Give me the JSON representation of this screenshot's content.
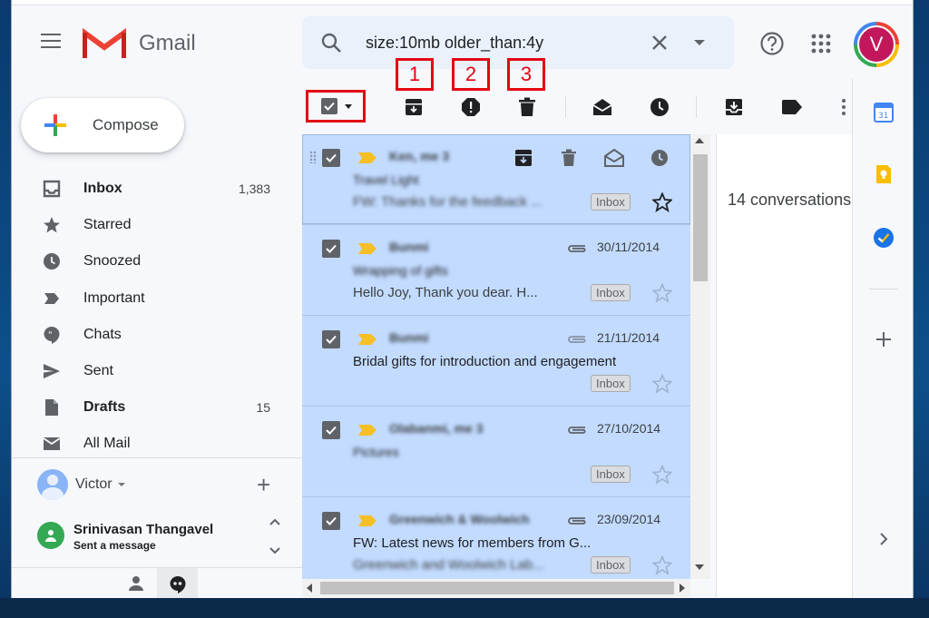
{
  "header": {
    "app_name": "Gmail",
    "search_query": "size:10mb older_than:4y",
    "avatar_letter": "V"
  },
  "compose": {
    "label": "Compose"
  },
  "nav": {
    "items": [
      {
        "label": "Inbox",
        "count": "1,383",
        "icon": "inbox-icon",
        "bold": true
      },
      {
        "label": "Starred",
        "count": "",
        "icon": "star-icon",
        "bold": false
      },
      {
        "label": "Snoozed",
        "count": "",
        "icon": "clock-icon",
        "bold": false
      },
      {
        "label": "Important",
        "count": "",
        "icon": "important-icon",
        "bold": false
      },
      {
        "label": "Chats",
        "count": "",
        "icon": "chat-icon",
        "bold": false
      },
      {
        "label": "Sent",
        "count": "",
        "icon": "send-icon",
        "bold": false
      },
      {
        "label": "Drafts",
        "count": "15",
        "icon": "draft-icon",
        "bold": true
      },
      {
        "label": "All Mail",
        "count": "",
        "icon": "mail-icon",
        "bold": false
      }
    ]
  },
  "hangouts": {
    "user_name": "Victor",
    "contact_name": "Srinivasan Thangavel",
    "contact_status": "Sent a message"
  },
  "toolbar": {
    "callouts": [
      "1",
      "2",
      "3"
    ]
  },
  "emails": [
    {
      "sender": "Ken, me 3",
      "date": "",
      "subject": "Travel Light",
      "snippet": "FW: Thanks for the feedback ...",
      "label": "Inbox",
      "attachment": false,
      "hover": true
    },
    {
      "sender": "Bunmi",
      "date": "30/11/2014",
      "subject": "Wrapping of gifts",
      "snippet": "Hello Joy, Thank you dear. H...",
      "label": "Inbox",
      "attachment": true,
      "hover": false
    },
    {
      "sender": "Bunmi",
      "date": "21/11/2014",
      "subject": "Bridal gifts for introduction and engagement",
      "snippet": "",
      "label": "Inbox",
      "attachment": true,
      "hover": false
    },
    {
      "sender": "Olabanmi, me 3",
      "date": "27/10/2014",
      "subject": "Pictures",
      "snippet": "",
      "label": "Inbox",
      "attachment": true,
      "hover": false
    },
    {
      "sender": "Greenwich & Woolwich",
      "date": "23/09/2014",
      "subject": "FW: Latest news for members from G...",
      "snippet": "Greenwich and Woolwich Lab...",
      "label": "Inbox",
      "attachment": true,
      "hover": false
    }
  ],
  "reading_pane": {
    "text": "14 conversations"
  },
  "colors": {
    "selected_row": "#c2dbff",
    "callout_red": "#e30613",
    "important_yellow": "#f6bf26",
    "avatar_bg": "#c2185b"
  }
}
